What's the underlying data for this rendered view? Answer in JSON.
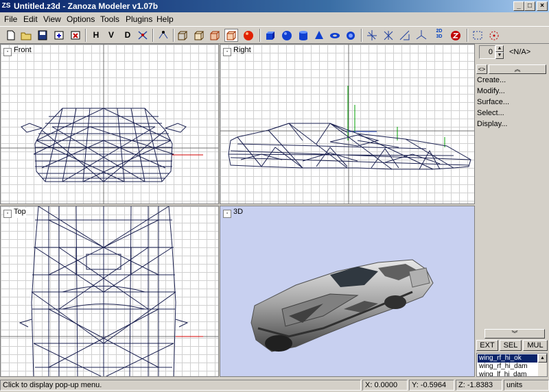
{
  "window": {
    "title": "Untitled.z3d - Zanoza Modeler v1.07b",
    "app_icon": "ZS",
    "minimize": "_",
    "maximize": "□",
    "close": "×"
  },
  "menu": [
    "File",
    "Edit",
    "View",
    "Options",
    "Tools",
    "Plugins",
    "Help"
  ],
  "toolbar": {
    "h": "H",
    "v": "V",
    "d": "D",
    "two_d": "2D",
    "three_d": "3D"
  },
  "viewports": {
    "front": "Front",
    "right": "Right",
    "top": "Top",
    "view3d": "3D"
  },
  "panel": {
    "spinner_value": "0",
    "object_name": "<N/A>",
    "items": [
      "Create...",
      "Modify...",
      "Surface...",
      "Select...",
      "Display..."
    ],
    "mode_buttons": [
      "EXT",
      "SEL",
      "MUL"
    ],
    "list": [
      "wing_rf_hi_ok",
      "wing_rf_hi_dam",
      "wing_lf_hi_dam"
    ]
  },
  "status": {
    "hint": "Click to display pop-up menu.",
    "x": "X: 0.0000",
    "y": "Y: -0.5964",
    "z": "Z: -1.8383",
    "units": "units"
  },
  "colors": {
    "wire": "#1a2050",
    "viewport3d_bg": "#c8d0f0",
    "titlebar": "#0a246a"
  }
}
